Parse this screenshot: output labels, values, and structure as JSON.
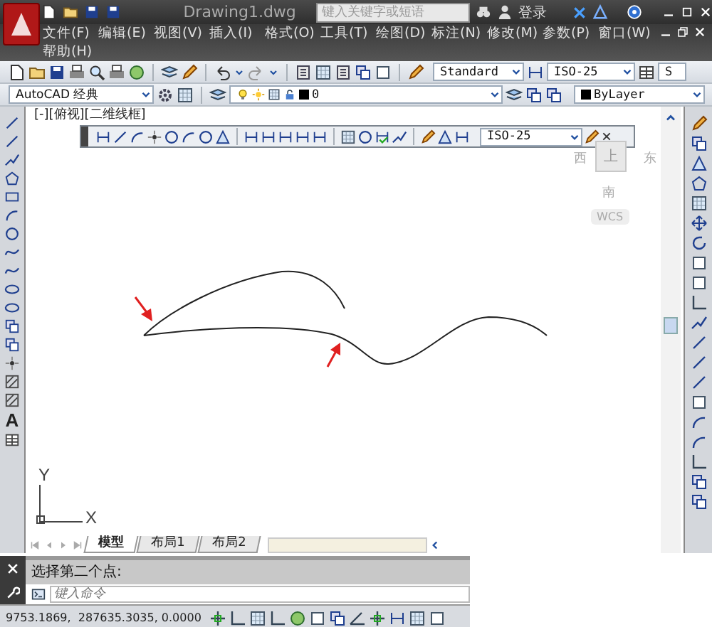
{
  "title_bar": {
    "title": "Drawing1.dwg",
    "search": {
      "placeholder": "键入关键字或短语"
    },
    "sign_in": "登录"
  },
  "menu": [
    "文件(F)",
    "编辑(E)",
    "视图(V)",
    "插入(I)",
    "格式(O)",
    "工具(T)",
    "绘图(D)",
    "标注(N)",
    "修改(M)",
    "参数(P)",
    "窗口(W)",
    "帮助(H)"
  ],
  "styles_toolbar": {
    "text_style": "Standard",
    "dimension_style": "ISO-25",
    "table_style": "S"
  },
  "workspace_toolbar": {
    "workspace": "AutoCAD 经典",
    "layer": "0",
    "color_control": "ByLayer"
  },
  "viewport_label": "[-][俯视][二维线框]",
  "dimension_toolbar": {
    "dimension_style": "ISO-25"
  },
  "viewcube": {
    "west": "西",
    "top": "上",
    "east": "东",
    "south": "南",
    "wcs": "WCS"
  },
  "draw_toolbar": {
    "text_tool": "A"
  },
  "ucs": {
    "x": "X",
    "y": "Y"
  },
  "layout_tabs": [
    {
      "label": "模型",
      "selected": true
    },
    {
      "label": "布局1",
      "selected": false
    },
    {
      "label": "布局2",
      "selected": false
    }
  ],
  "command_line": {
    "history": "选择第二个点:",
    "placeholder": "键入命令"
  },
  "status_bar": {
    "coordinates": "9753.1869,  287635.3035, 0.0000"
  }
}
